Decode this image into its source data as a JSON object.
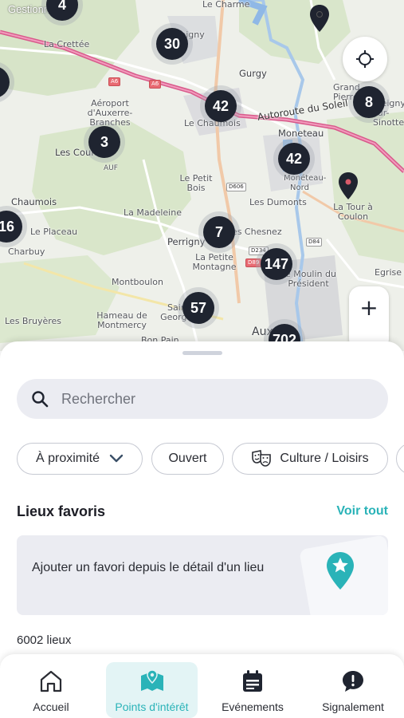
{
  "status_bar": {
    "carrier": "Gestionnaire"
  },
  "map": {
    "place_labels": [
      {
        "text": "Le Charme"
      },
      {
        "text": "La Crettée"
      },
      {
        "text": "Appoigny"
      },
      {
        "text": "Gurgy"
      },
      {
        "text": "Aéroport d'Auxerre-Branches"
      },
      {
        "text": "Le Chaumois"
      },
      {
        "text": "Moneteau"
      },
      {
        "text": "Les Cours"
      },
      {
        "text": "AUF"
      },
      {
        "text": "Le Petit Bois"
      },
      {
        "text": "Chaumois"
      },
      {
        "text": "La Madeleine"
      },
      {
        "text": "Les Dumonts"
      },
      {
        "text": "Le Placeau"
      },
      {
        "text": "Perrigny"
      },
      {
        "text": "Les Chesnez"
      },
      {
        "text": "La Petite Montagne"
      },
      {
        "text": "Charbuy"
      },
      {
        "text": "Montboulon"
      },
      {
        "text": "Saint-Georges-sur-Baulche"
      },
      {
        "text": "Hameau de Montmercy"
      },
      {
        "text": "Les Bruyères"
      },
      {
        "text": "Bon Pain"
      },
      {
        "text": "Auxerre"
      },
      {
        "text": "La Tour à Coulon"
      },
      {
        "text": "Grand Pierre"
      },
      {
        "text": "Egrise"
      },
      {
        "text": "Bleigny-sur-Sinotte"
      },
      {
        "text": "Le Moulin du Président"
      },
      {
        "text": "Monéteau-Nord"
      }
    ],
    "highway_label": "Autoroute du Soleil",
    "road_badges": [
      "A6",
      "A6",
      "D606",
      "D234",
      "D89",
      "D84"
    ],
    "clusters": [
      {
        "count": "30"
      },
      {
        "count": "42"
      },
      {
        "count": "8"
      },
      {
        "count": "3"
      },
      {
        "count": "42"
      },
      {
        "count": "16"
      },
      {
        "count": "7"
      },
      {
        "count": "147"
      },
      {
        "count": "57"
      },
      {
        "count": "702"
      },
      {
        "count": "4"
      }
    ],
    "zoom_in_label": "+"
  },
  "search": {
    "placeholder": "Rechercher",
    "value": ""
  },
  "filters": [
    {
      "label": "À proximité"
    },
    {
      "label": "Ouvert"
    },
    {
      "label": "Culture / Loisirs"
    }
  ],
  "favorites": {
    "title": "Lieux favoris",
    "see_all": "Voir tout",
    "empty_text": "Ajouter un favori depuis le détail d'un lieu"
  },
  "places_count": "6002 lieux",
  "tabs": [
    {
      "label": "Accueil"
    },
    {
      "label": "Points d'intérêt"
    },
    {
      "label": "Evénements"
    },
    {
      "label": "Signalement"
    }
  ],
  "colors": {
    "accent": "#2ab3b8",
    "cluster": "#1f2430",
    "highway": "#d85a8b",
    "sheet_bg": "#ffffff",
    "chip_border": "#c6c9d2"
  }
}
